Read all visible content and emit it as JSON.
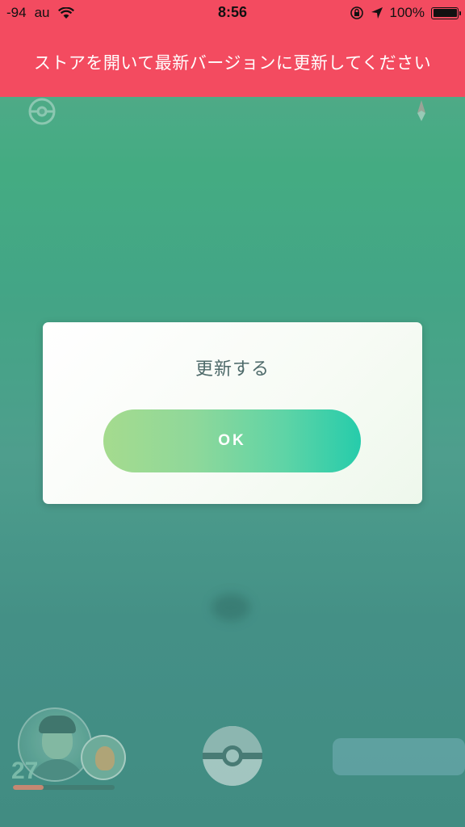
{
  "status_bar": {
    "signal": "-94",
    "carrier": "au",
    "time": "8:56",
    "battery_percent": "100%",
    "icons": [
      "wifi-icon",
      "rotation-lock-icon",
      "location-arrow-icon",
      "battery-icon"
    ]
  },
  "banner": {
    "text": "ストアを開いて最新バージョンに更新してください",
    "background": "#f34b60"
  },
  "dialog": {
    "message": "更新する",
    "ok_label": "OK",
    "button_gradient": [
      "#a5db8e",
      "#26ccab"
    ]
  },
  "hud": {
    "trainer_level": "27",
    "xp_progress": 0.3,
    "icons": [
      "pokeball-icon",
      "compass-icon",
      "avatar",
      "buddy-pokemon",
      "main-menu-pokeball-icon",
      "nearby-panel"
    ]
  }
}
